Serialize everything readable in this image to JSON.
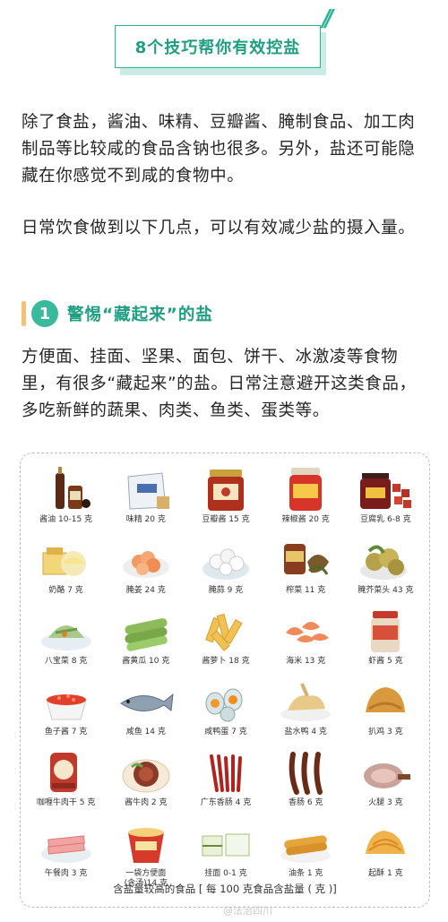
{
  "title": "8个技巧帮你有效控盐",
  "paragraph1": "除了食盐，酱油、味精、豆瓣酱、腌制食品、加工肉制品等比较咸的食品含钠也很多。另外，盐还可能隐藏在你感觉不到咸的食物中。",
  "paragraph2": "日常饮食做到以下几点，可以有效减少盐的摄入量。",
  "section": {
    "number": "1",
    "title": "警惕“藏起来”的盐"
  },
  "paragraph3": "方便面、挂面、坚果、面包、饼干、冰激凌等食物里，有很多“藏起来”的盐。日常注意避开这类食品，多吃新鲜的蔬果、肉类、鱼类、蛋类等。",
  "foods": [
    {
      "label": "酱油 10-15 克",
      "icon": "soy-sauce-bottle"
    },
    {
      "label": "味精 20 克",
      "icon": "msg-bag"
    },
    {
      "label": "豆瓣酱 15 克",
      "icon": "bean-paste-jar"
    },
    {
      "label": "辣椒酱 20 克",
      "icon": "chili-sauce-jar"
    },
    {
      "label": "豆腐乳 6-8 克",
      "icon": "fermented-tofu-jar"
    },
    {
      "label": "奶酪 7 克",
      "icon": "cheese"
    },
    {
      "label": "腌姜 24 克",
      "icon": "pickled-ginger"
    },
    {
      "label": "腌蒜 9 克",
      "icon": "pickled-garlic"
    },
    {
      "label": "榨菜 11 克",
      "icon": "zhacai"
    },
    {
      "label": "腌芥菜头 43 克",
      "icon": "pickled-mustard"
    },
    {
      "label": "八宝菜 8 克",
      "icon": "mixed-pickles"
    },
    {
      "label": "酱黄瓜 10 克",
      "icon": "pickled-cucumber"
    },
    {
      "label": "酱萝卜 18 克",
      "icon": "pickled-radish"
    },
    {
      "label": "海米 13 克",
      "icon": "dried-shrimp"
    },
    {
      "label": "虾酱 5 克",
      "icon": "shrimp-paste-jar"
    },
    {
      "label": "鱼子酱 7 克",
      "icon": "caviar"
    },
    {
      "label": "咸鱼 14 克",
      "icon": "salted-fish"
    },
    {
      "label": "咸鸭蛋 7 克",
      "icon": "salted-duck-egg"
    },
    {
      "label": "盐水鸭 4 克",
      "icon": "salted-duck"
    },
    {
      "label": "扒鸡 3 克",
      "icon": "braised-chicken"
    },
    {
      "label": "咖喱牛肉干 5 克",
      "icon": "beef-jerky"
    },
    {
      "label": "酱牛肉 2 克",
      "icon": "braised-beef"
    },
    {
      "label": "广东香肠 4 克",
      "icon": "cantonese-sausage"
    },
    {
      "label": "香肠 6 克",
      "icon": "sausage"
    },
    {
      "label": "火腿 3 克",
      "icon": "ham"
    },
    {
      "label": "午餐肉 3 克",
      "icon": "luncheon-meat"
    },
    {
      "label": "一袋方便面\n(含汤)14 克",
      "icon": "instant-noodles"
    },
    {
      "label": "挂面 0-1 克",
      "icon": "dried-noodles"
    },
    {
      "label": "油条 1 克",
      "icon": "youtiao"
    },
    {
      "label": "起酥 1 克",
      "icon": "puff-pastry"
    }
  ],
  "footnote": "含盐量较高的食品 [ 每 100 克食品含盐量 ( 克 )]",
  "watermark": "@法治四川"
}
